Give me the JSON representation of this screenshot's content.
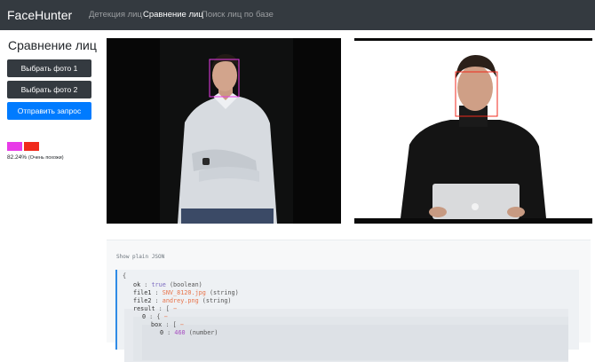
{
  "navbar": {
    "brand": "FaceHunter",
    "links": [
      {
        "label": "Детекция лиц",
        "active": false
      },
      {
        "label": "Сравнение лиц",
        "active": true
      },
      {
        "label": "Поиск лиц по базе",
        "active": false
      }
    ]
  },
  "sidebar": {
    "title": "Сравнение лиц",
    "buttons": {
      "select_photo_1": "Выбрать фото 1",
      "select_photo_2": "Выбрать фото 2",
      "submit": "Отправить запрос"
    },
    "swatch_colors": [
      "#e83be8",
      "#f02a1c"
    ],
    "similarity_value": "82.24%",
    "similarity_note": "(Очень похожи)"
  },
  "photos": {
    "box_colors": [
      "#e83be8",
      "#f02a1c"
    ]
  },
  "json_viewer": {
    "toggle_label": "Show plain JSON",
    "lines": [
      {
        "open": "{"
      },
      {
        "key": "ok",
        "sep": " : ",
        "value": "true",
        "type": "(boolean)",
        "kind": "bool"
      },
      {
        "key": "file1",
        "sep": " : ",
        "value": "SNV_8120.jpg",
        "type": "(string)",
        "kind": "str"
      },
      {
        "key": "file2",
        "sep": " : ",
        "value": "andrey.png",
        "type": "(string)",
        "kind": "str"
      },
      {
        "key": "result",
        "sep": " : ",
        "bracket": "[",
        "collapse": "−"
      },
      {
        "key": "0",
        "sep": " : ",
        "bracket": "{",
        "collapse": "−"
      },
      {
        "key": "box",
        "sep": " : ",
        "bracket": "[",
        "collapse": "−"
      },
      {
        "key": "0",
        "sep": " : ",
        "value": "460",
        "type": "(number)",
        "kind": "num"
      }
    ]
  }
}
